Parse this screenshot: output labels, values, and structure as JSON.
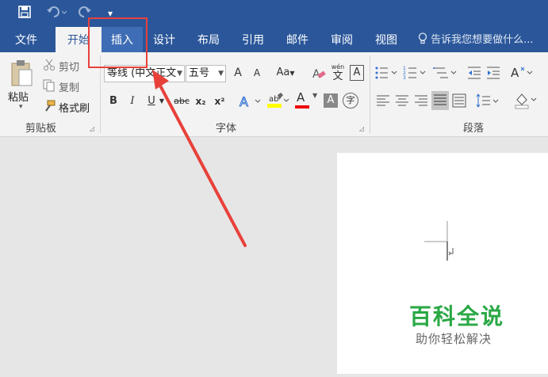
{
  "quick_access": {
    "redo_dropdown": "▾"
  },
  "tabs": [
    {
      "label": "文件"
    },
    {
      "label": "开始"
    },
    {
      "label": "插入"
    },
    {
      "label": "设计"
    },
    {
      "label": "布局"
    },
    {
      "label": "引用"
    },
    {
      "label": "邮件"
    },
    {
      "label": "审阅"
    },
    {
      "label": "视图"
    }
  ],
  "tell_me": "告诉我您想要做什么...",
  "clipboard": {
    "paste": "粘贴",
    "cut": "剪切",
    "copy": "复制",
    "format_painter": "格式刷",
    "group_label": "剪贴板"
  },
  "font": {
    "font_name": "等线 (中文正文",
    "font_size": "五号",
    "grow": "A",
    "shrink": "A",
    "change_case": "Aa",
    "phonetic_top": "wén",
    "phonetic_bottom": "文",
    "char_border": "A",
    "bold": "B",
    "italic": "I",
    "underline": "U",
    "strikethrough": "abc",
    "subscript": "x₂",
    "superscript": "x²",
    "font_color": "A",
    "char_shading": "A",
    "enclose": "字",
    "group_label": "字体"
  },
  "paragraph": {
    "group_label": "段落"
  },
  "watermark": {
    "title": "百科全说",
    "subtitle": "助你轻松解决"
  },
  "colors": {
    "ribbon_blue": "#2b579a",
    "highlight_red": "#e8413a",
    "watermark_green": "#2aa845"
  }
}
